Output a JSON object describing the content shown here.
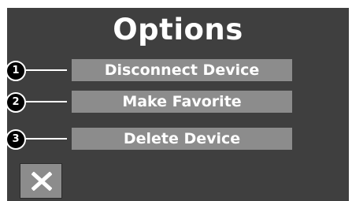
{
  "header": {
    "title": "Options"
  },
  "options": [
    {
      "number": "1",
      "label": "Disconnect Device"
    },
    {
      "number": "2",
      "label": "Make Favorite"
    },
    {
      "number": "3",
      "label": "Delete Device"
    }
  ],
  "close_button": {
    "icon": "close-icon"
  },
  "colors": {
    "background": "#3f3f3f",
    "button": "#8c8c8c",
    "text": "#ffffff",
    "callout": "#000000"
  }
}
